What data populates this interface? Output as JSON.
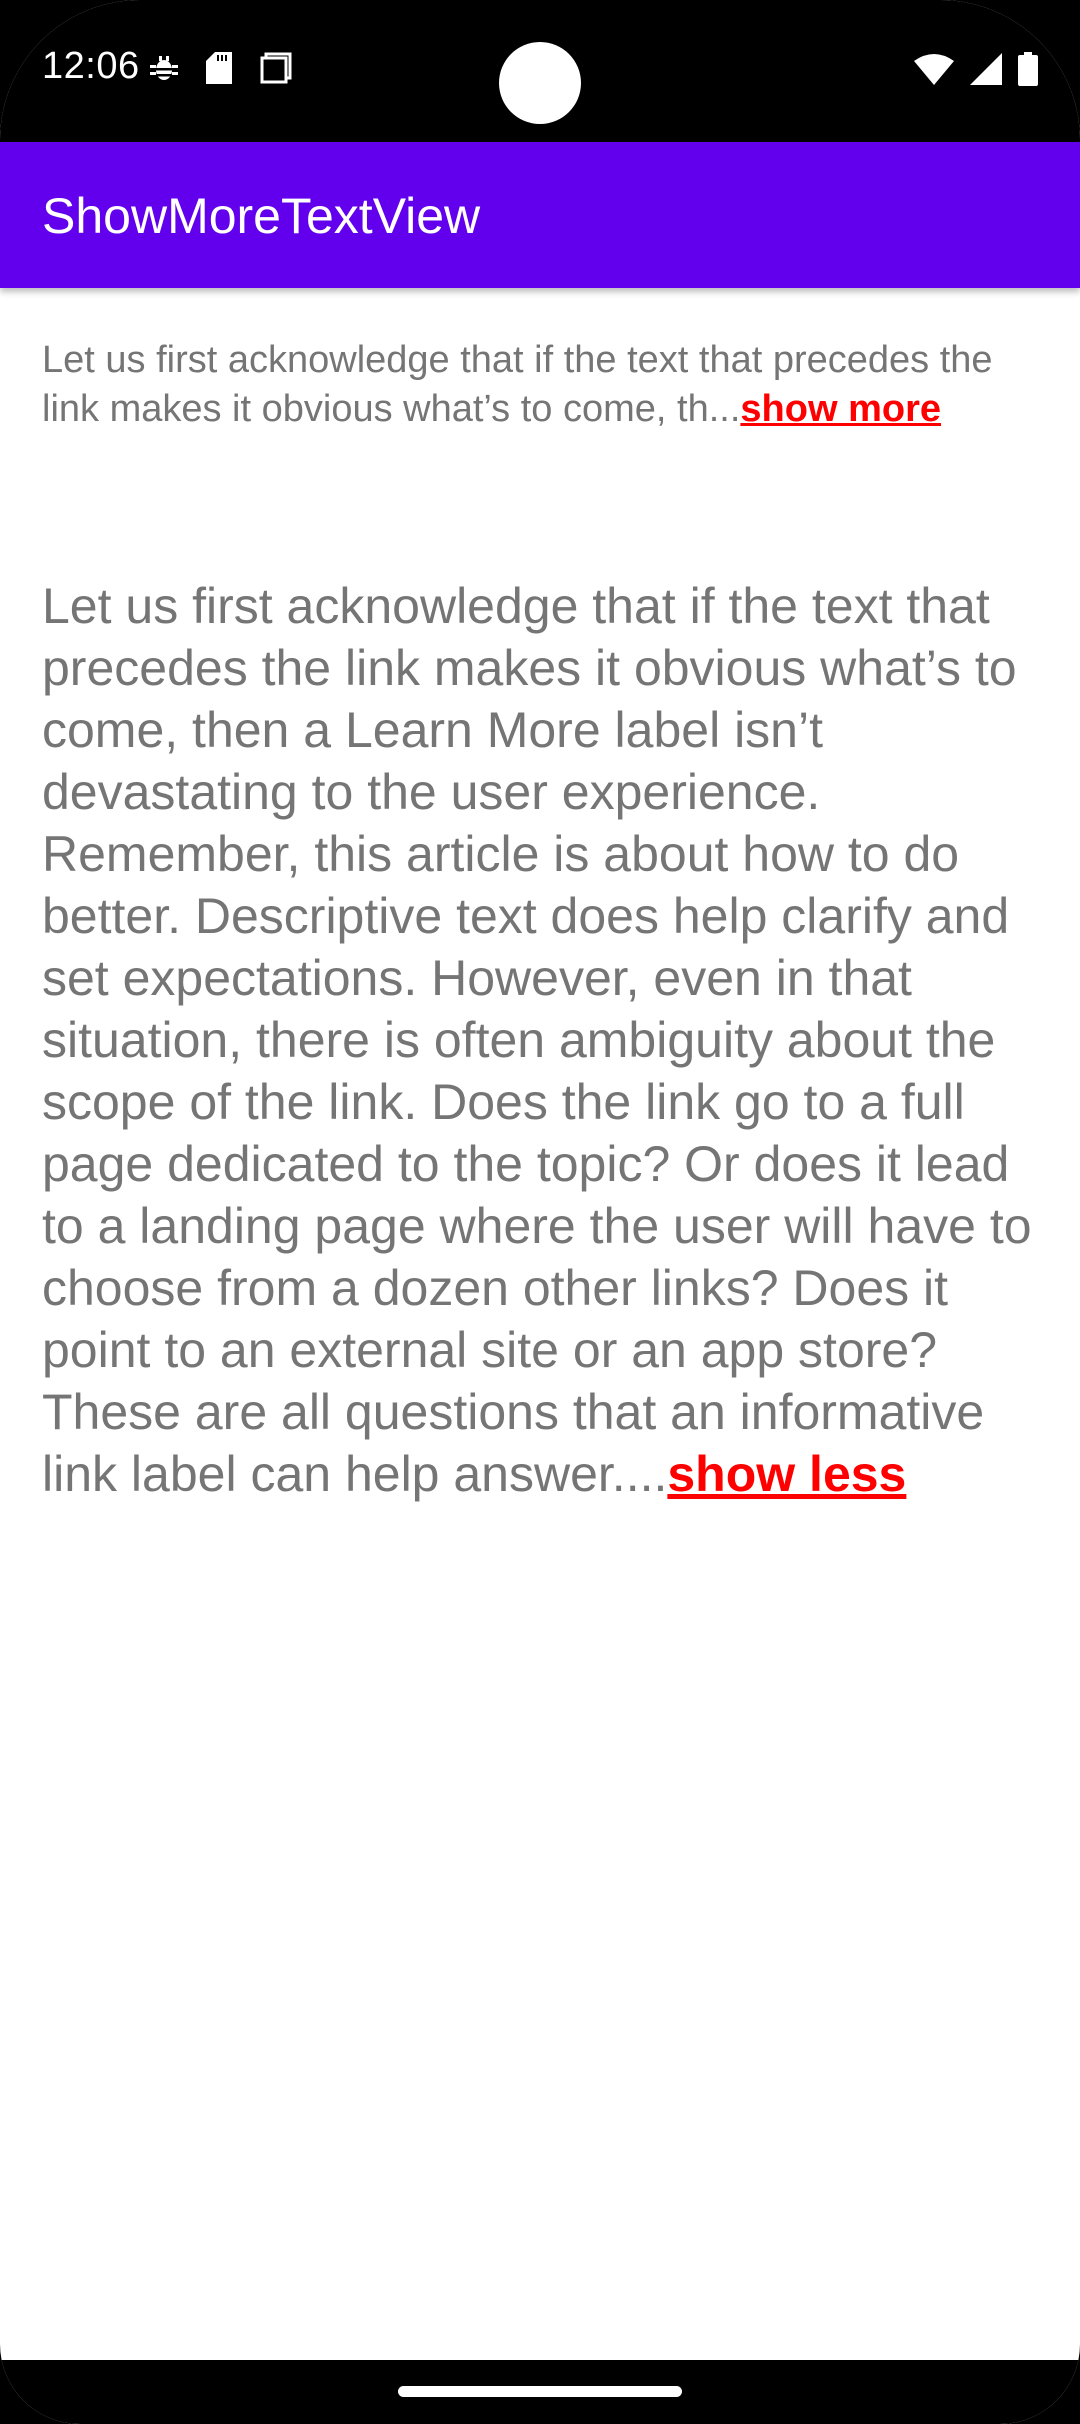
{
  "status_bar": {
    "time": "12:06",
    "icons_left": [
      "bug-icon",
      "sd-card-icon",
      "screenshot-icon"
    ],
    "icons_right": [
      "wifi-icon",
      "signal-icon",
      "battery-icon"
    ]
  },
  "app_bar": {
    "title": "ShowMoreTextView",
    "color": "#6200ee"
  },
  "collapsed_text": {
    "body": "Let us first acknowledge that if the text that precedes the link makes it obvious what’s to come, th...",
    "link_label": "show more"
  },
  "expanded_text": {
    "body": "Let us first acknowledge that if the text that precedes the link makes it obvious what’s to come, then a Learn More label isn’t devastating to the user experience. Remember, this article is about how to do better. Descriptive text does help clarify and set expectations. However, even in that situation, there is often ambiguity about the scope of the link. Does the link go to a full page dedicated to the topic? Or does it lead to a landing page where the user will have to choose from a dozen other links? Does it point to an external site or an app store? These are all questions that an informative link label can help answer....",
    "link_label": "show less"
  },
  "colors": {
    "text": "#757575",
    "link": "#ff0000"
  }
}
